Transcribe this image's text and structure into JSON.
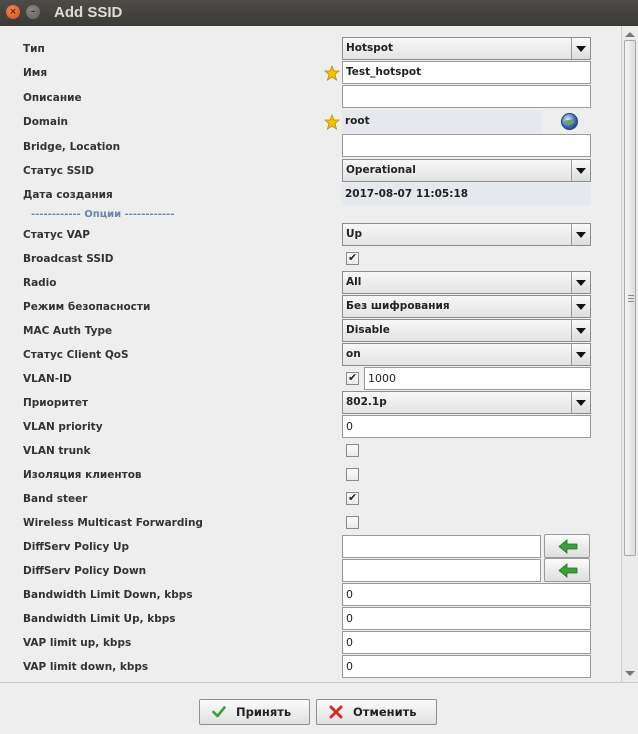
{
  "window": {
    "title": "Add SSID",
    "close_glyph": "×",
    "min_glyph": "–"
  },
  "form": {
    "type_label": "Тип",
    "type_value": "Hotspot",
    "name_label": "Имя",
    "name_value": "Test_hotspot",
    "description_label": "Описание",
    "description_value": "",
    "domain_label": "Domain",
    "domain_value": "root",
    "bridge_label": "Bridge, Location",
    "bridge_value": "",
    "ssid_status_label": "Статус SSID",
    "ssid_status_value": "Operational",
    "created_label": "Дата создания",
    "created_value": "2017-08-07 11:05:18",
    "options_header": "------------ Опции ------------",
    "vap_status_label": "Статус VAP",
    "vap_status_value": "Up",
    "broadcast_label": "Broadcast SSID",
    "broadcast_checked": true,
    "radio_label": "Radio",
    "radio_value": "All",
    "security_label": "Режим безопасности",
    "security_value": "Без шифрования",
    "mac_auth_label": "MAC Auth Type",
    "mac_auth_value": "Disable",
    "client_qos_label": "Статус Client QoS",
    "client_qos_value": "on",
    "vlan_id_label": "VLAN-ID",
    "vlan_id_checked": true,
    "vlan_id_value": "1000",
    "priority_label": "Приоритет",
    "priority_value": "802.1p",
    "vlan_priority_label": "VLAN priority",
    "vlan_priority_value": "0",
    "vlan_trunk_label": "VLAN trunk",
    "vlan_trunk_checked": false,
    "isolation_label": "Изоляция клиентов",
    "isolation_checked": false,
    "band_steer_label": "Band steer",
    "band_steer_checked": true,
    "multicast_label": "Wireless Multicast Forwarding",
    "multicast_checked": false,
    "diffserv_up_label": "DiffServ Policy Up",
    "diffserv_up_value": "",
    "diffserv_down_label": "DiffServ Policy Down",
    "diffserv_down_value": "",
    "bw_down_label": "Bandwidth Limit Down, kbps",
    "bw_down_value": "0",
    "bw_up_label": "Bandwidth Limit Up, kbps",
    "bw_up_value": "0",
    "vap_up_label": "VAP limit up, kbps",
    "vap_up_value": "0",
    "vap_down_label": "VAP limit down, kbps",
    "vap_down_value": "0",
    "check_glyph": "✔"
  },
  "footer": {
    "accept_label": "Принять",
    "cancel_label": "Отменить"
  },
  "icons": {
    "required": "star-icon",
    "domain_picker": "globe-icon",
    "select_arrow": "chevron-down-icon",
    "diffserv_pick": "green-arrow-left-icon",
    "accept": "green-check-icon",
    "cancel": "red-x-icon"
  },
  "colors": {
    "titlebar": "#3c3b37",
    "section_header": "#6b86a8",
    "accept_icon": "#3aa13a",
    "cancel_icon": "#d42b2b",
    "star": "#f5c400"
  }
}
